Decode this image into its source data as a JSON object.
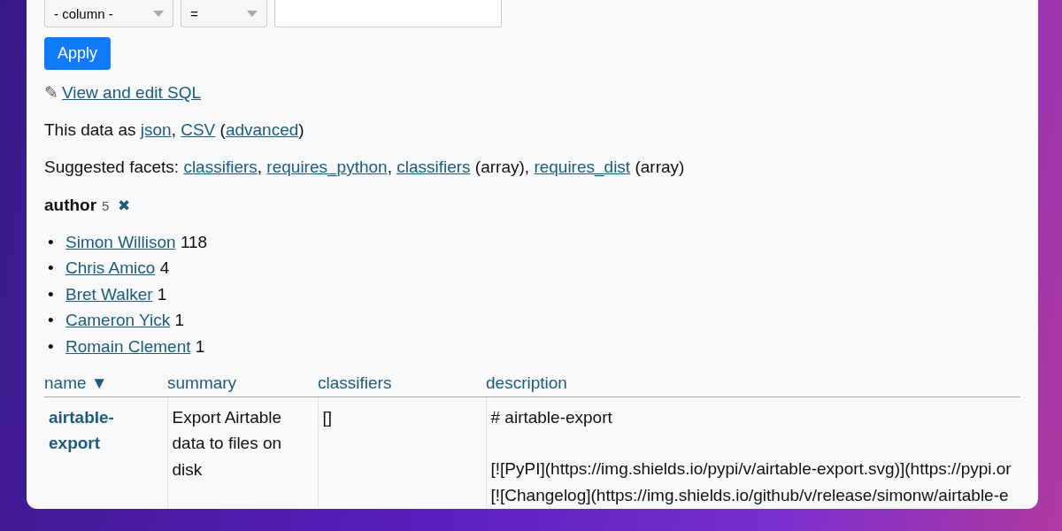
{
  "filter": {
    "column": "- column -",
    "operator": "="
  },
  "apply_button": "Apply",
  "sql_link": {
    "icon": "✎",
    "label": "View and edit SQL"
  },
  "export_line": [
    {
      "kind": "text",
      "text": "This data as "
    },
    {
      "kind": "link",
      "text": "json"
    },
    {
      "kind": "text",
      "text": ", "
    },
    {
      "kind": "link",
      "text": "CSV"
    },
    {
      "kind": "text",
      "text": " ("
    },
    {
      "kind": "link",
      "text": "advanced"
    },
    {
      "kind": "text",
      "text": ")"
    }
  ],
  "suggested_facets": [
    {
      "kind": "text",
      "text": "Suggested facets: "
    },
    {
      "kind": "link",
      "text": "classifiers"
    },
    {
      "kind": "text",
      "text": ", "
    },
    {
      "kind": "link",
      "text": "requires_python"
    },
    {
      "kind": "text",
      "text": ", "
    },
    {
      "kind": "link",
      "text": "classifiers"
    },
    {
      "kind": "text",
      "text": " (array), "
    },
    {
      "kind": "link",
      "text": "requires_dist"
    },
    {
      "kind": "text",
      "text": " (array)"
    }
  ],
  "facet": {
    "title": "author",
    "count": "5",
    "remove": "✖",
    "items": [
      {
        "bullet": "•",
        "name": "Simon Willison",
        "count": "118"
      },
      {
        "bullet": "•",
        "name": "Chris Amico",
        "count": "4"
      },
      {
        "bullet": "•",
        "name": "Bret Walker",
        "count": "1"
      },
      {
        "bullet": "•",
        "name": "Cameron Yick",
        "count": "1"
      },
      {
        "bullet": "•",
        "name": "Romain Clement",
        "count": "1"
      }
    ]
  },
  "table": {
    "columns": [
      {
        "label": "name",
        "sort": "▼"
      },
      {
        "label": "summary"
      },
      {
        "label": "classifiers"
      },
      {
        "label": "description"
      }
    ],
    "rows": [
      {
        "name": "airtable-export",
        "summary": "Export Airtable data to files on disk",
        "classifiers": "[]",
        "description": [
          [
            "# airtable-export"
          ],
          [
            "[![PyPI](https://img.shields.io/pypi/v/airtable-export.svg)](https://pypi.or",
            "[![Changelog](https://img.shields.io/github/v/release/simonw/airtable-e"
          ]
        ]
      }
    ]
  }
}
